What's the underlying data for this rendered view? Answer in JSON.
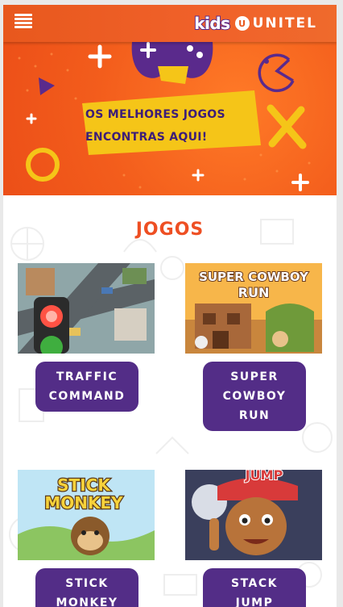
{
  "header": {
    "menu_icon": "hamburger-menu-icon",
    "logo_kids": "kids",
    "logo_unitel": "UNITEL"
  },
  "banner": {
    "line1": "OS MELHORES JOGOS",
    "line2": "ENCONTRAS AQUI!",
    "colors": {
      "background": "#f35d1c",
      "accent_yellow": "#f5c518",
      "accent_purple": "#3d1d78"
    }
  },
  "section": {
    "title": "JOGOS"
  },
  "games": [
    {
      "title_line1": "TRAFFIC",
      "title_line2": "COMMAND",
      "title_line3": ""
    },
    {
      "title_line1": "SUPER",
      "title_line2": "COWBOY",
      "title_line3": "RUN"
    },
    {
      "title_line1": "STICK",
      "title_line2": "MONKEY",
      "title_line3": ""
    },
    {
      "title_line1": "STACK",
      "title_line2": "JUMP",
      "title_line3": ""
    }
  ],
  "thumb_text": {
    "cowboy_line1": "SUPER COWBOY",
    "cowboy_line2": "RUN",
    "monkey_line1": "STICK",
    "monkey_line2": "MONKEY",
    "jump": "JUMP"
  },
  "colors": {
    "accent": "#ee4f23",
    "button": "#532d87"
  }
}
